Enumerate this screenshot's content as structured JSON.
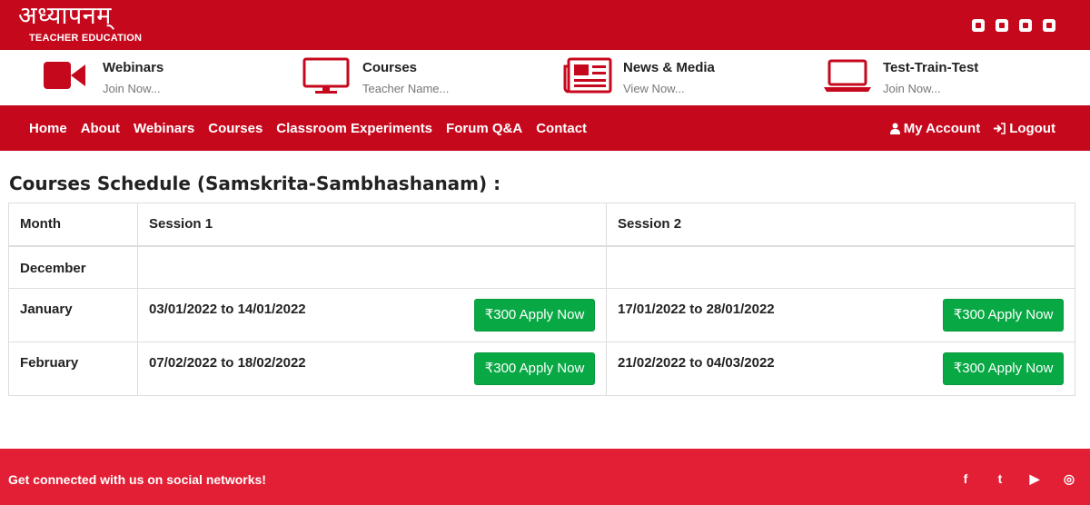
{
  "brand": {
    "logo_main": "अध्यापनम्",
    "logo_sub": "TEACHER EDUCATION"
  },
  "colors": {
    "primary": "#c6081d",
    "footer": "#e31f35",
    "button": "#08a944"
  },
  "top_social_icons": [
    "facebook-icon",
    "twitter-icon",
    "instagram-icon",
    "youtube-icon"
  ],
  "quick_links": [
    {
      "title": "Webinars",
      "sub": "Join Now...",
      "icon": "video-camera-icon"
    },
    {
      "title": "Courses",
      "sub": "Teacher Name...",
      "icon": "monitor-icon"
    },
    {
      "title": "News & Media",
      "sub": "View Now...",
      "icon": "newspaper-icon"
    },
    {
      "title": "Test-Train-Test",
      "sub": "Join Now...",
      "icon": "laptop-icon"
    }
  ],
  "nav": {
    "items": [
      "Home",
      "About",
      "Webinars",
      "Courses",
      "Classroom Experiments",
      "Forum Q&A",
      "Contact"
    ],
    "account": "My Account",
    "logout": "Logout"
  },
  "schedule": {
    "title": "Courses Schedule (Samskrita-Sambhashanam) :",
    "headers": [
      "Month",
      "Session 1",
      "Session 2"
    ],
    "rows": [
      {
        "month": "December",
        "s1": "",
        "s2": ""
      },
      {
        "month": "January",
        "s1": "03/01/2022 to 14/01/2022",
        "s1_btn": "₹300 Apply Now",
        "s2": "17/01/2022 to 28/01/2022",
        "s2_btn": "₹300 Apply Now"
      },
      {
        "month": "February",
        "s1": "07/02/2022 to 18/02/2022",
        "s1_btn": "₹300 Apply Now",
        "s2": "21/02/2022 to 04/03/2022",
        "s2_btn": "₹300 Apply Now"
      }
    ]
  },
  "footer": {
    "text": "Get connected with us on social networks!",
    "icons": [
      "facebook-icon",
      "twitter-icon",
      "youtube-icon",
      "instagram-icon"
    ],
    "glyphs": [
      "f",
      "t",
      "▶",
      "◎"
    ]
  }
}
